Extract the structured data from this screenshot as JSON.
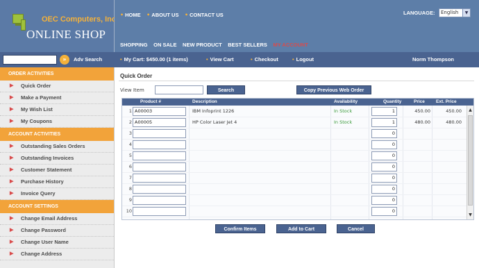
{
  "brand": {
    "company": "OEC Computers, Inc.",
    "shop": "ONLINE SHOP"
  },
  "top_links": [
    "HOME",
    "ABOUT US",
    "CONTACT US"
  ],
  "language": {
    "label": "LANGUAGE:",
    "selected": "English"
  },
  "shop_nav": [
    "SHOPPING",
    "ON SALE",
    "NEW PRODUCT",
    "BEST SELLERS",
    "MY ACCOUNT"
  ],
  "search": {
    "value": "",
    "adv_label": "Adv Search",
    "go_icon": "search-go-icon"
  },
  "cart_bar": {
    "cart": "My Cart: $450.00 (1 items)",
    "view_cart": "View Cart",
    "checkout": "Checkout",
    "logout": "Logout",
    "user": "Norm Thompson"
  },
  "sidebar": {
    "sections": [
      {
        "title": "ORDER ACTIVITIES",
        "items": [
          "Quick Order",
          "Make a Payment",
          "My Wish List",
          "My Coupons"
        ]
      },
      {
        "title": "ACCOUNT ACTIVITIES",
        "items": [
          "Outstanding Sales Orders",
          "Outstanding Invoices",
          "Customer Statement",
          "Purchase History",
          "Invoice Query"
        ]
      },
      {
        "title": "ACCOUNT SETTINGS",
        "items": [
          "Change Email Address",
          "Change Password",
          "Change User Name",
          "Change Address"
        ]
      }
    ]
  },
  "main": {
    "title": "Quick Order",
    "view_item_label": "View Item",
    "view_item_value": "",
    "search_btn": "Search",
    "copy_btn": "Copy Previous Web Order",
    "columns": [
      "Product #",
      "Description",
      "Availability",
      "Quantity",
      "Price",
      "Ext. Price"
    ],
    "rows": [
      {
        "num": "1",
        "product": "A00003",
        "description": "IBM Infoprint 1226",
        "availability": "In Stock",
        "qty": "1",
        "price": "450.00",
        "ext": "450.00"
      },
      {
        "num": "2",
        "product": "A00005",
        "description": "HP Color Laser Jet 4",
        "availability": "In Stock",
        "qty": "1",
        "price": "480.00",
        "ext": "480.00"
      },
      {
        "num": "3",
        "product": "",
        "description": "",
        "availability": "",
        "qty": "0",
        "price": "",
        "ext": ""
      },
      {
        "num": "4",
        "product": "",
        "description": "",
        "availability": "",
        "qty": "0",
        "price": "",
        "ext": ""
      },
      {
        "num": "5",
        "product": "",
        "description": "",
        "availability": "",
        "qty": "0",
        "price": "",
        "ext": ""
      },
      {
        "num": "6",
        "product": "",
        "description": "",
        "availability": "",
        "qty": "0",
        "price": "",
        "ext": ""
      },
      {
        "num": "7",
        "product": "",
        "description": "",
        "availability": "",
        "qty": "0",
        "price": "",
        "ext": ""
      },
      {
        "num": "8",
        "product": "",
        "description": "",
        "availability": "",
        "qty": "0",
        "price": "",
        "ext": ""
      },
      {
        "num": "9",
        "product": "",
        "description": "",
        "availability": "",
        "qty": "0",
        "price": "",
        "ext": ""
      },
      {
        "num": "10",
        "product": "",
        "description": "",
        "availability": "",
        "qty": "0",
        "price": "",
        "ext": ""
      }
    ],
    "confirm_btn": "Confirm Items",
    "add_btn": "Add to Cart",
    "cancel_btn": "Cancel"
  },
  "colors": {
    "header": "#5d7ea8",
    "bar": "#4a6390",
    "accent": "#f2a33a",
    "link_red": "#d94b4b",
    "in_stock": "#3a9a3a"
  }
}
